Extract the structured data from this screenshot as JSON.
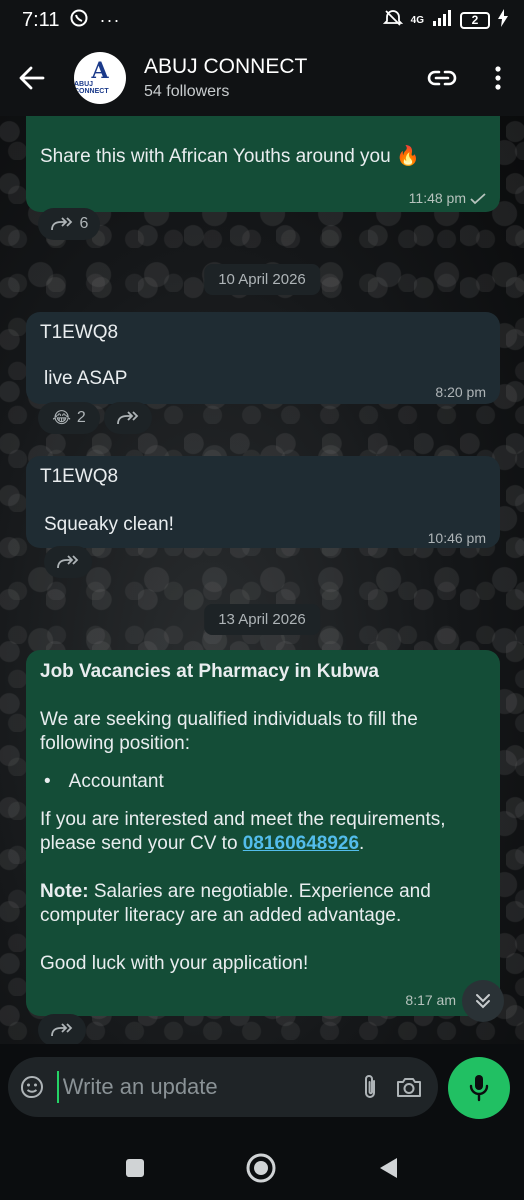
{
  "status_bar": {
    "time": "7:11",
    "network": "4G",
    "battery": "2"
  },
  "header": {
    "channel_name": "ABUJ CONNECT",
    "followers": "54 followers",
    "avatar_text": "ABUJ CONNECT",
    "avatar_initial": "A"
  },
  "messages": {
    "m1": {
      "text": "Share this with African Youths around you 🔥",
      "time": "11:48 pm",
      "forwards": "6"
    },
    "date1": "10 April 2026",
    "m2": {
      "sender": "T1EWQ8",
      "text": "live ASAP",
      "time": "8:20 pm",
      "reaction_emoji": "😂",
      "reaction_count": "2"
    },
    "m3": {
      "sender": "T1EWQ8",
      "text": "Squeaky clean!",
      "time": "10:46 pm"
    },
    "date2": "13 April 2026",
    "m4": {
      "title": "Job Vacancies at Pharmacy in Kubwa",
      "p1": "We are seeking qualified individuals to fill the following position:",
      "bullet": "Accountant",
      "p2_pre": "If you are interested and meet the requirements, please send your CV to ",
      "phone": "08160648926",
      "p2_post": ".",
      "note_label": "Note:",
      "note_text": " Salaries are negotiable. Experience and computer literacy are an added advantage.",
      "closing": "Good luck with your application!",
      "time": "8:17 am"
    }
  },
  "composer": {
    "placeholder": "Write an update"
  },
  "colors": {
    "outgoing_bubble": "#144d37",
    "incoming_bubble": "#1f2c33",
    "accent": "#21c063",
    "link": "#53bdeb"
  }
}
